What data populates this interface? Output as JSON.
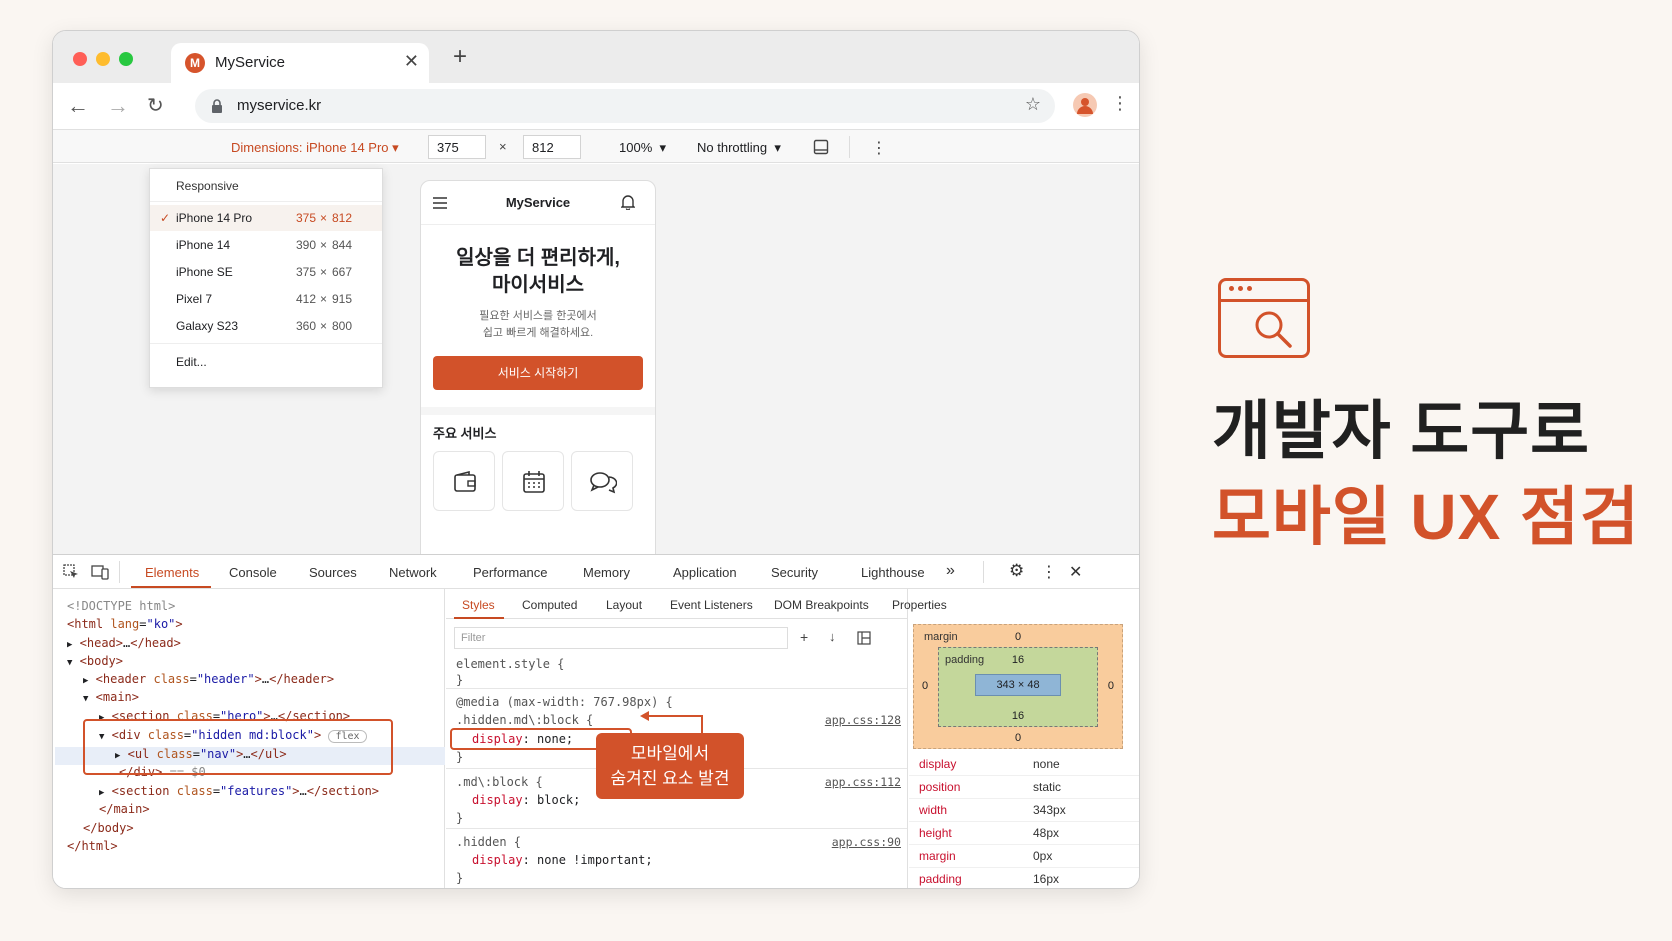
{
  "browser": {
    "tab_title": "MyService",
    "favicon_letter": "M",
    "url": "myservice.kr"
  },
  "device_toolbar": {
    "dimensions_label": "Dimensions: iPhone 14 Pro",
    "width": "375",
    "height": "812",
    "times": "×",
    "zoom": "100%",
    "throttling": "No throttling"
  },
  "device_menu": {
    "header": "Responsive",
    "items": [
      {
        "name": "iPhone 14 Pro",
        "w": "375",
        "h": "812",
        "selected": true
      },
      {
        "name": "iPhone 14",
        "w": "390",
        "h": "844",
        "selected": false
      },
      {
        "name": "iPhone SE",
        "w": "375",
        "h": "667",
        "selected": false
      },
      {
        "name": "Pixel 7",
        "w": "412",
        "h": "915",
        "selected": false
      },
      {
        "name": "Galaxy S23",
        "w": "360",
        "h": "800",
        "selected": false
      }
    ],
    "edit": "Edit..."
  },
  "phone": {
    "brand": "MyService",
    "hero_line1": "일상을 더 편리하게,",
    "hero_line2": "마이서비스",
    "desc_line1": "필요한 서비스를 한곳에서",
    "desc_line2": "쉽고 빠르게 해결하세요.",
    "cta": "서비스 시작하기",
    "section_title": "주요 서비스"
  },
  "devtools": {
    "tabs": [
      "Elements",
      "Console",
      "Sources",
      "Network",
      "Performance",
      "Memory",
      "Application",
      "Security",
      "Lighthouse"
    ],
    "more": "»",
    "style_tabs": [
      "Styles",
      "Computed",
      "Layout",
      "Event Listeners",
      "DOM Breakpoints",
      "Properties"
    ],
    "filter_placeholder": "Filter",
    "dom": {
      "doctype": "<!DOCTYPE html>",
      "html_open": "<html",
      "lang_attr": "lang",
      "lang_val": "\"ko\"",
      "head": "<head>",
      "head_close": "</head>",
      "body": "<body>",
      "header_open": "<header",
      "class_attr": "class",
      "header_val": "\"header\"",
      "header_close": "</header>",
      "main": "<main>",
      "section_open": "<section",
      "hero_val": "\"hero\"",
      "section_close": "</section>",
      "div_open": "<div",
      "div_val": "\"hidden md:block\"",
      "flex_badge": "flex",
      "ul_open": "<ul",
      "nav_val": "\"nav\"",
      "ul_close": "</ul>",
      "div_close": "</div>",
      "selected_marker": "== $0",
      "features_val": "\"features\"",
      "main_close": "</main>",
      "body_close": "</body>",
      "html_close": "</html>",
      "ellipsis": "…"
    },
    "styles": {
      "element_style": "element.style {",
      "close": "}",
      "media": "@media (max-width: 767.98px) {",
      "sel1": ".hidden.md\\:block {",
      "src1": "app.css:128",
      "decl1_prop": "display",
      "decl1_val": "none;",
      "sel2": ".md\\:block {",
      "src2": "app.css:112",
      "decl2_prop": "display",
      "decl2_val": "block;",
      "sel3": ".hidden {",
      "src3": "app.css:90",
      "decl3_prop": "display",
      "decl3_val": "none !important;"
    },
    "box_model": {
      "margin_label": "margin",
      "padding_label": "padding",
      "margin_top": "0",
      "margin_right": "0",
      "margin_bottom": "0",
      "margin_left": "0",
      "padding_top": "16",
      "padding_bottom": "16",
      "content": "343 × 48"
    },
    "computed": [
      {
        "key": "display",
        "value": "none"
      },
      {
        "key": "position",
        "value": "static"
      },
      {
        "key": "width",
        "value": "343px"
      },
      {
        "key": "height",
        "value": "48px"
      },
      {
        "key": "margin",
        "value": "0px"
      },
      {
        "key": "padding",
        "value": "16px"
      }
    ]
  },
  "callout": {
    "line1": "모바일에서",
    "line2": "숨겨진 요소 발견"
  },
  "headline": {
    "line1": "개발자 도구로",
    "line2": "모바일 UX 점검"
  },
  "colors": {
    "accent": "#d2522a",
    "traffic_red": "#ff5f57",
    "traffic_yellow": "#febc2e",
    "traffic_green": "#28c840"
  }
}
